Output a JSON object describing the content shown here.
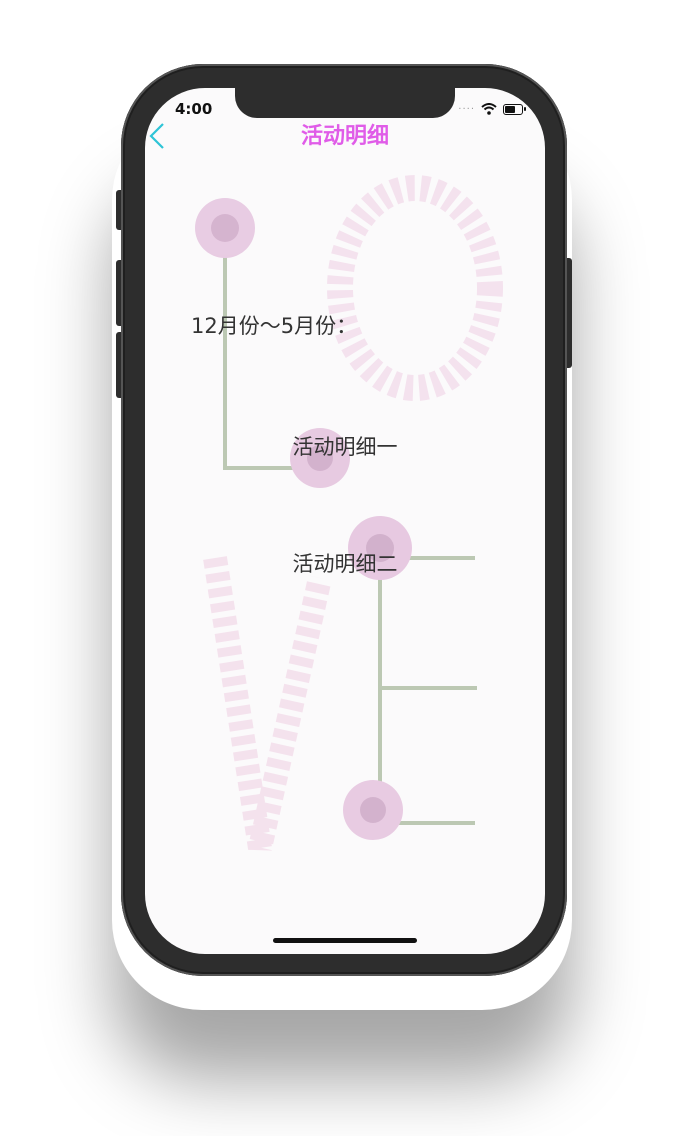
{
  "status_bar": {
    "time": "4:00",
    "signal_dots": "····"
  },
  "nav": {
    "title": "活动明细",
    "back_icon": "chevron-left-icon"
  },
  "content": {
    "range_label": "12月份～5月份：",
    "items": [
      {
        "label": "活动明细一"
      },
      {
        "label": "活动明细二"
      }
    ]
  },
  "colors": {
    "title": "#e05ce8",
    "back_arrow": "#2ec4d6",
    "text": "#333333"
  }
}
